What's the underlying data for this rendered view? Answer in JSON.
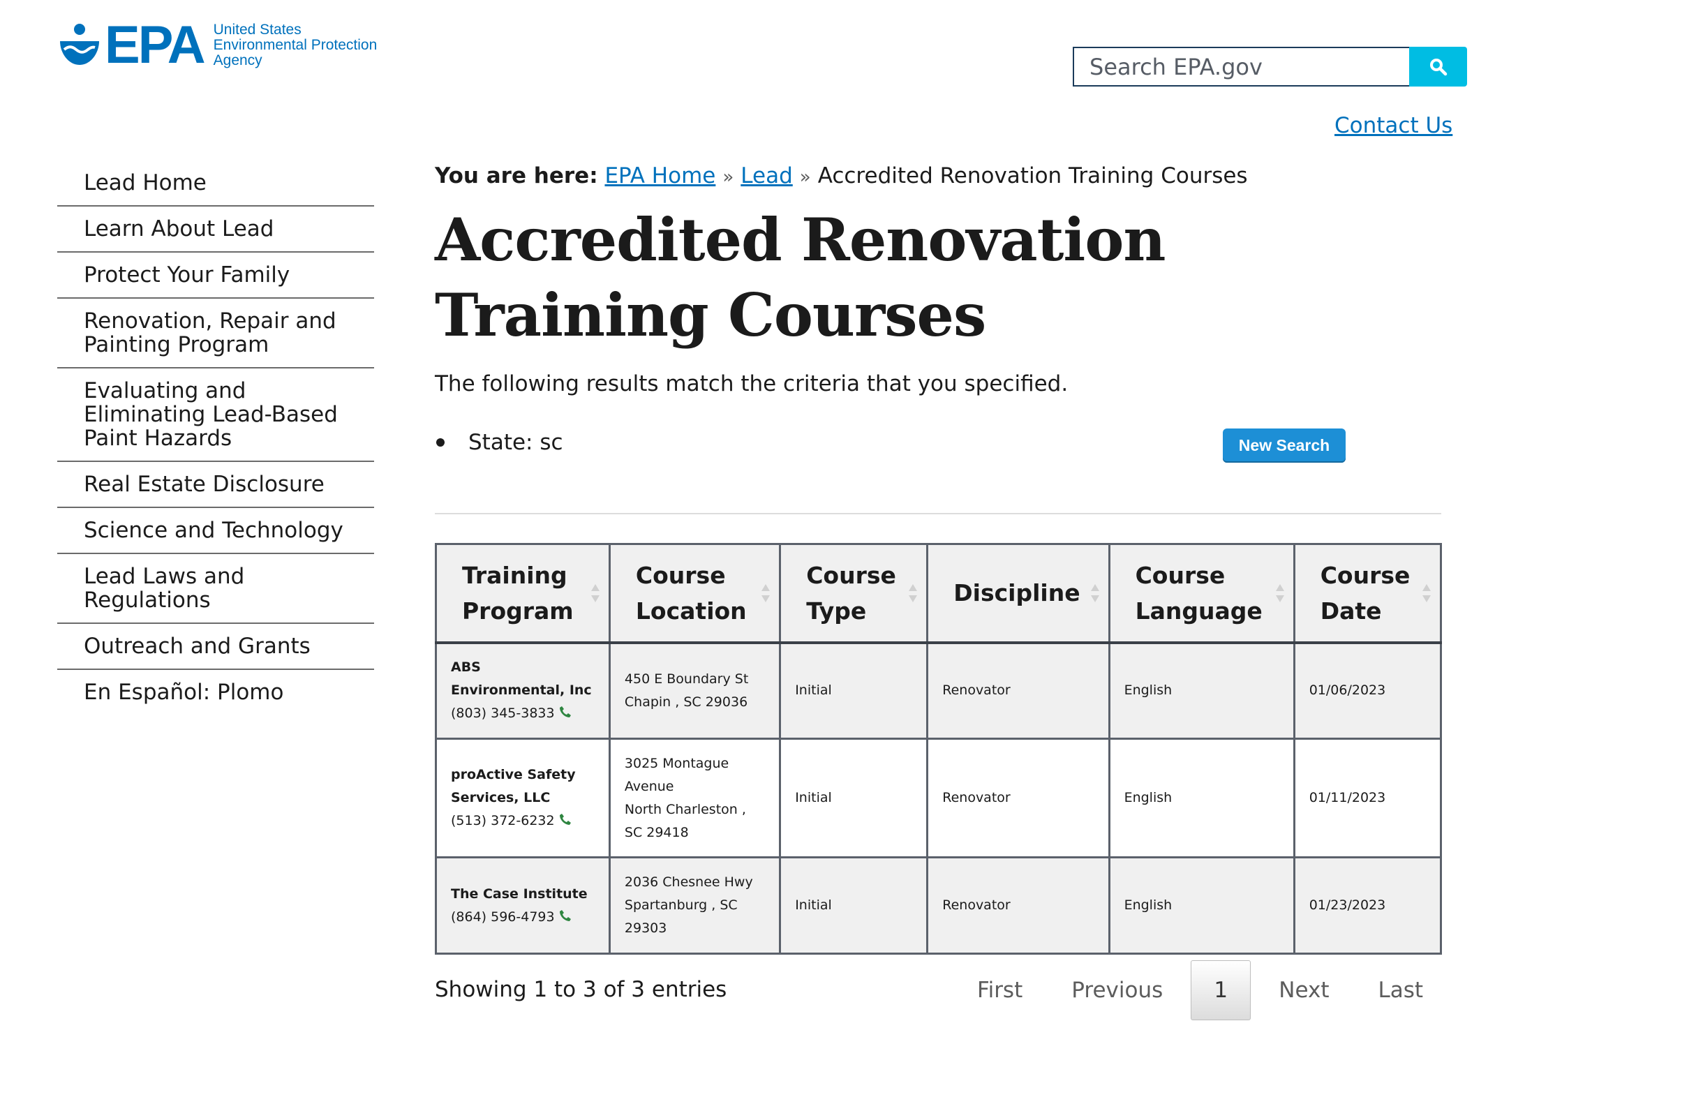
{
  "header": {
    "logo_letters": "EPA",
    "logo_line1": "United States",
    "logo_line2": "Environmental Protection",
    "logo_line3": "Agency",
    "search_placeholder": "Search EPA.gov",
    "contact_label": "Contact Us"
  },
  "sidenav": {
    "items": [
      "Lead Home",
      "Learn About Lead",
      "Protect Your Family",
      "Renovation, Repair and Painting Program",
      "Evaluating and Eliminating Lead-Based Paint Hazards",
      "Real Estate Disclosure",
      "Science and Technology",
      "Lead Laws and Regulations",
      "Outreach and Grants",
      "En Español: Plomo"
    ]
  },
  "breadcrumb": {
    "prefix": "You are here:",
    "crumbs": [
      "EPA Home",
      "Lead"
    ],
    "current": "Accredited Renovation Training Courses"
  },
  "page": {
    "title": "Accredited Renovation Training Courses",
    "lead": "The following results match the criteria that you specified.",
    "criteria": "State: sc",
    "new_search_label": "New Search"
  },
  "table": {
    "headers": [
      "Training Program",
      "Course Location",
      "Course Type",
      "Discipline",
      "Course Language",
      "Course Date"
    ],
    "rows": [
      {
        "program": "ABS Environmental, Inc",
        "phone": "(803) 345-3833",
        "location_street": "450 E Boundary St",
        "location_city": "Chapin , SC 29036",
        "type": "Initial",
        "discipline": "Renovator",
        "language": "English",
        "date": "01/06/2023"
      },
      {
        "program": "proActive Safety Services, LLC",
        "phone": "(513) 372-6232",
        "location_street": "3025 Montague Avenue",
        "location_city": "North Charleston , SC 29418",
        "type": "Initial",
        "discipline": "Renovator",
        "language": "English",
        "date": "01/11/2023"
      },
      {
        "program": "The Case Institute",
        "phone": "(864) 596-4793",
        "location_street": "2036 Chesnee Hwy",
        "location_city": "Spartanburg , SC 29303",
        "type": "Initial",
        "discipline": "Renovator",
        "language": "English",
        "date": "01/23/2023"
      }
    ]
  },
  "pagination": {
    "showing": "Showing 1 to 3 of 3 entries",
    "first": "First",
    "previous": "Previous",
    "current_page": "1",
    "next": "Next",
    "last": "Last"
  },
  "colors": {
    "brand_blue": "#0071bc",
    "search_button": "#00bde3",
    "new_search_button": "#1d8fd6",
    "phone_icon": "#2e8540"
  }
}
